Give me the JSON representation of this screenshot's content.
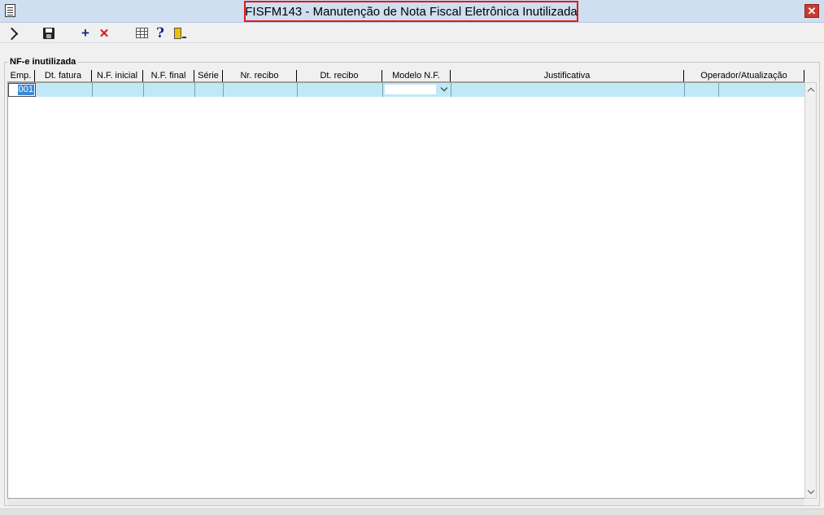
{
  "window": {
    "title": "FISFM143 - Manutenção de Nota Fiscal Eletrônica Inutilizada",
    "close_label": "✕"
  },
  "toolbar": {
    "icons": [
      "navigate-arrow-icon",
      "save-icon",
      "add-icon",
      "delete-icon",
      "grid-icon",
      "help-icon",
      "exit-icon"
    ],
    "add_label": "+",
    "delete_label": "✕",
    "help_label": "?"
  },
  "colors": {
    "title_highlight": "#e01b1b",
    "titlebar": "#cfdef0",
    "selected_row": "#bfe9f6",
    "cell_focus": "#3a89d6"
  },
  "section": {
    "title": "NF-e inutilizada"
  },
  "table": {
    "columns": [
      "Emp.",
      "Dt. fatura",
      "N.F. inicial",
      "N.F. final",
      "Série",
      "Nr. recibo",
      "Dt. recibo",
      "Modelo N.F.",
      "Justificativa",
      "Operador/Atualização"
    ],
    "rows": [
      {
        "emp": "001",
        "dt_fatura": "",
        "nf_inicial": "",
        "nf_final": "",
        "serie": "",
        "nr_recibo": "",
        "dt_recibo": "",
        "modelo_nf": "",
        "justificativa": "",
        "operador": "",
        "atualizacao": ""
      }
    ]
  }
}
